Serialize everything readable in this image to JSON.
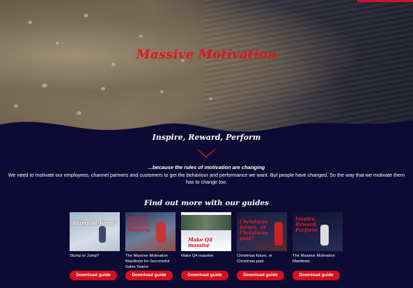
{
  "hero": {
    "title": "Massive Motivation",
    "tagline": "Inspire, Reward, Perform"
  },
  "intro": {
    "subheading": "...because the rules of motivation are changing",
    "line1": "We need to motivate our employees, channel partners and customers to get the behaviour and performance we want. But people have changed. So the way that we motivate them",
    "line2": "has to change too."
  },
  "guides": {
    "title": "Find out more with our guides",
    "button_label": "Download guide",
    "items": [
      {
        "title": "Slump or Jump?",
        "cover_text": "Slump or Jump?"
      },
      {
        "title": "The Massive Motivation Manifesto for Successful Sales Teams",
        "cover_text": "Inspire, Reward, Perform"
      },
      {
        "title": "Make Q4 massive",
        "cover_text": "Make Q4 massive"
      },
      {
        "title": "Christmas future, or Christmas past",
        "cover_text": "Christmas future, or Christmas past?"
      },
      {
        "title": "The Massive Motivation Manifesto",
        "cover_text": "Inspire, Reward, Perform"
      }
    ]
  },
  "colors": {
    "background": "#0d0b33",
    "accent": "#d8101e"
  }
}
